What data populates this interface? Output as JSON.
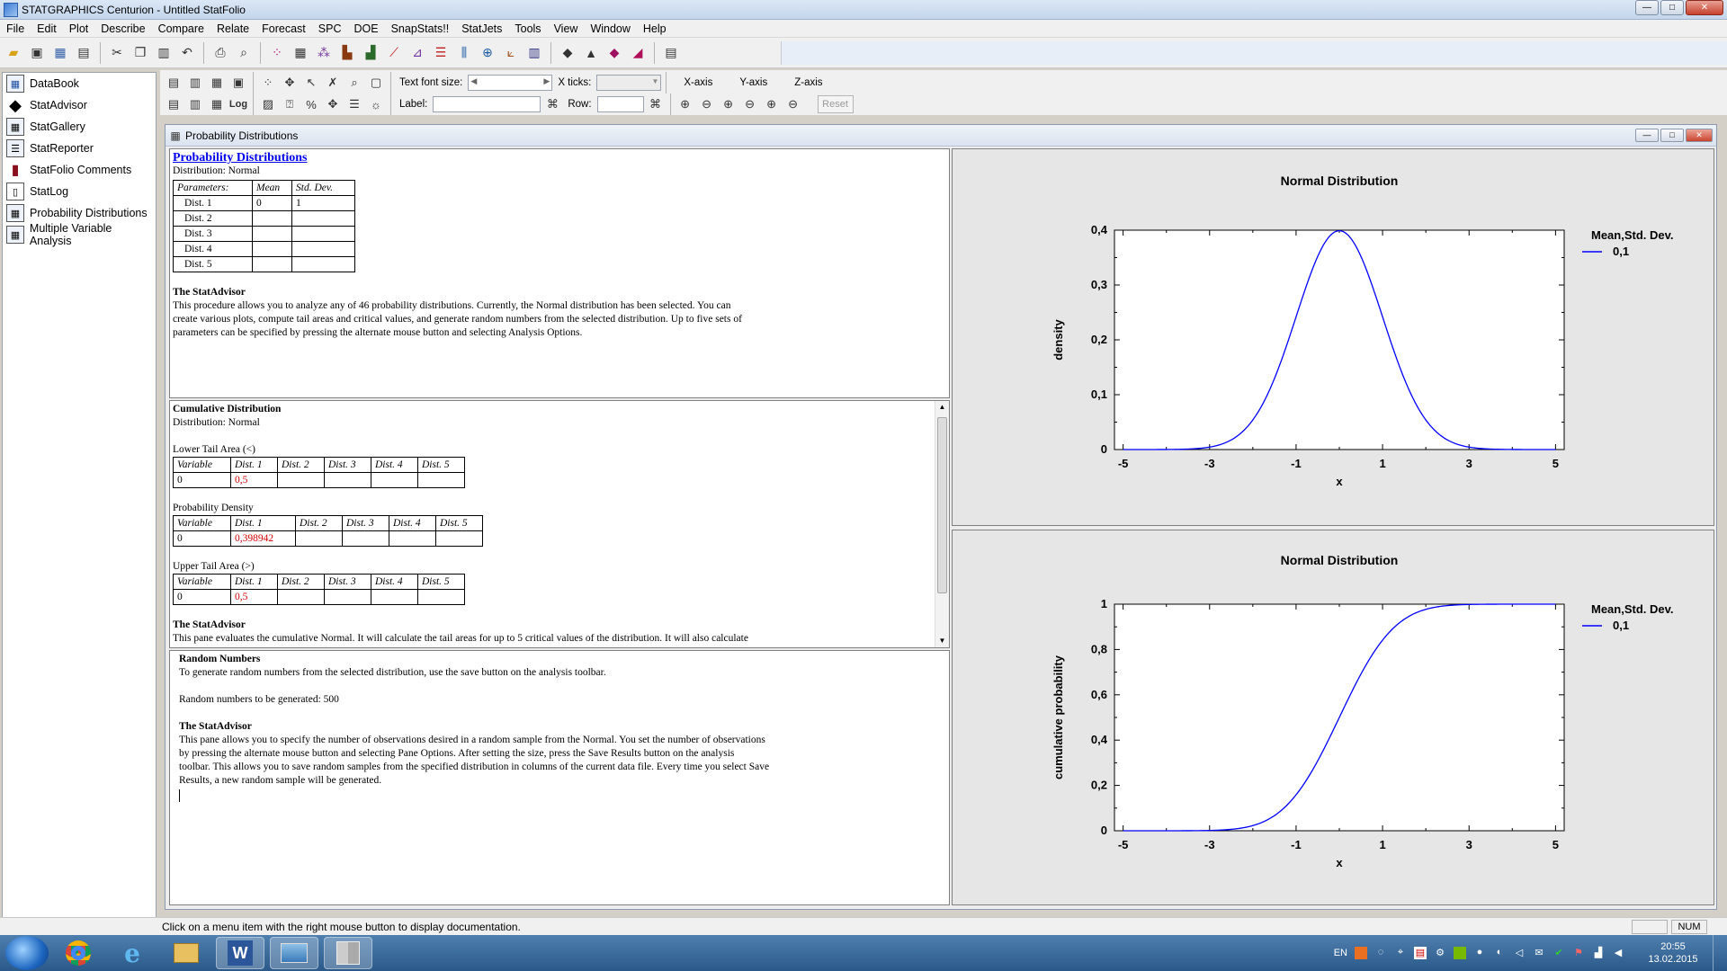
{
  "window": {
    "title": "STATGRAPHICS Centurion - Untitled StatFolio",
    "min_symbol": "—",
    "max_symbol": "□",
    "close_symbol": "✕"
  },
  "menu": [
    "File",
    "Edit",
    "Plot",
    "Describe",
    "Compare",
    "Relate",
    "Forecast",
    "SPC",
    "DOE",
    "SnapStats!!",
    "StatJets",
    "Tools",
    "View",
    "Window",
    "Help"
  ],
  "nav": [
    {
      "label": "DataBook",
      "icon": "databook-icon"
    },
    {
      "label": "StatAdvisor",
      "icon": "statadvisor-icon"
    },
    {
      "label": "StatGallery",
      "icon": "statgallery-icon"
    },
    {
      "label": "StatReporter",
      "icon": "statreporter-icon"
    },
    {
      "label": "StatFolio Comments",
      "icon": "comments-icon"
    },
    {
      "label": "StatLog",
      "icon": "statlog-icon"
    },
    {
      "label": "Probability Distributions",
      "icon": "distributions-icon"
    },
    {
      "label": "Multiple Variable Analysis",
      "icon": "multivariable-icon"
    }
  ],
  "toolbar2": {
    "text_font_size_label": "Text font size:",
    "xticks_label": "X ticks:",
    "xaxis": "X-axis",
    "yaxis": "Y-axis",
    "zaxis": "Z-axis",
    "label_label": "Label:",
    "row_label": "Row:",
    "reset": "Reset",
    "log_label": "Log",
    "left_arrow": "◀",
    "right_arrow": "▶",
    "dropdown_arrow": "▼"
  },
  "mdi": {
    "title": "Probability Distributions"
  },
  "analysis_pane": {
    "title": "Probability Distributions",
    "distribution": "Distribution: Normal",
    "param_headers": [
      "Parameters:",
      "Mean",
      "Std. Dev."
    ],
    "param_rows": [
      [
        "Dist. 1",
        "0",
        "1"
      ],
      [
        "Dist. 2",
        "",
        ""
      ],
      [
        "Dist. 3",
        "",
        ""
      ],
      [
        "Dist. 4",
        "",
        ""
      ],
      [
        "Dist. 5",
        "",
        ""
      ]
    ],
    "advisor_title": "The StatAdvisor",
    "advisor_lines": [
      "This procedure allows you to analyze any of 46 probability distributions.  Currently, the Normal distribution has been selected.  You can",
      "create various plots, compute tail areas and critical values, and generate random numbers from the selected distribution.  Up to five sets of",
      "parameters can be specified by pressing the alternate mouse button and selecting Analysis Options."
    ]
  },
  "cumulative_pane": {
    "title": "Cumulative Distribution",
    "distribution": "Distribution: Normal",
    "lower_label": "Lower Tail Area (<)",
    "density_label": "Probability Density",
    "upper_label": "Upper Tail Area (>)",
    "headers": [
      "Variable",
      "Dist. 1",
      "Dist. 2",
      "Dist. 3",
      "Dist. 4",
      "Dist. 5"
    ],
    "lower_row": [
      "0",
      "0,5",
      "",
      "",
      "",
      ""
    ],
    "density_row": [
      "0",
      "0,398942",
      "",
      "",
      "",
      ""
    ],
    "upper_row": [
      "0",
      "0,5",
      "",
      "",
      "",
      ""
    ],
    "advisor_title": "The StatAdvisor",
    "advisor_lines": [
      "This pane evaluates the cumulative Normal.  It will calculate the tail areas for up to 5 critical values of the distribution.  It will also calculate"
    ],
    "scroll_up": "▲",
    "scroll_down": "▼"
  },
  "random_pane": {
    "title": "Random Numbers",
    "line1": "To generate random numbers from the selected distribution, use the save button on the analysis toolbar.",
    "line2": "Random numbers to be generated: 500",
    "advisor_title": "The StatAdvisor",
    "advisor_lines": [
      "This pane allows you to specify the number of observations desired in a random sample from the Normal.  You set the number of observations",
      "by pressing the alternate mouse button and selecting Pane Options.  After setting the size, press the Save Results button on the analysis",
      "toolbar.  This allows you to save random samples from the specified distribution in columns of the current data file.  Every time you select Save",
      "Results, a new random sample will be generated."
    ]
  },
  "chart_data": [
    {
      "type": "line",
      "title": "Normal Distribution",
      "xlabel": "x",
      "ylabel": "density",
      "xlim": [
        -5.2,
        5.2
      ],
      "ylim": [
        0,
        0.4
      ],
      "xticks": [
        -5,
        -3,
        -1,
        1,
        3,
        5
      ],
      "yticks": [
        0,
        0.1,
        0.2,
        0.3,
        0.4
      ],
      "yticklabels": [
        "0",
        "0,1",
        "0,2",
        "0,3",
        "0,4"
      ],
      "legend_title": "Mean,Std. Dev.",
      "series": [
        {
          "name": "0,1",
          "function": "normal_pdf",
          "mean": 0,
          "sd": 1,
          "color": "#0000ff"
        }
      ],
      "legend": "right"
    },
    {
      "type": "line",
      "title": "Normal Distribution",
      "xlabel": "x",
      "ylabel": "cumulative probability",
      "xlim": [
        -5.2,
        5.2
      ],
      "ylim": [
        0,
        1
      ],
      "xticks": [
        -5,
        -3,
        -1,
        1,
        3,
        5
      ],
      "yticks": [
        0,
        0.2,
        0.4,
        0.6,
        0.8,
        1
      ],
      "yticklabels": [
        "0",
        "0,2",
        "0,4",
        "0,6",
        "0,8",
        "1"
      ],
      "legend_title": "Mean,Std. Dev.",
      "series": [
        {
          "name": "0,1",
          "function": "normal_cdf",
          "mean": 0,
          "sd": 1,
          "color": "#0000ff"
        }
      ],
      "legend": "right"
    }
  ],
  "statusbar": {
    "text": "Click on a menu item with the right mouse button to display documentation.",
    "num": "NUM"
  },
  "taskbar": {
    "lang": "EN",
    "time": "20:55",
    "date": "13.02.2015",
    "word_letter": "W"
  }
}
